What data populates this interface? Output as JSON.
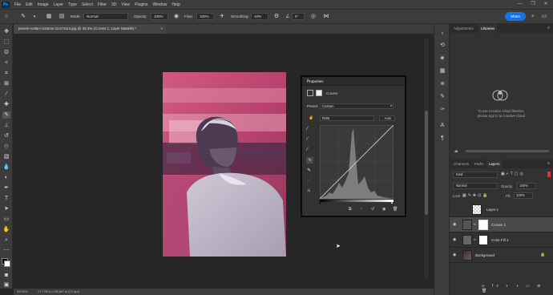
{
  "menubar": {
    "logo": "Ps",
    "items": [
      "File",
      "Edit",
      "Image",
      "Layer",
      "Type",
      "Select",
      "Filter",
      "3D",
      "View",
      "Plugins",
      "Window",
      "Help"
    ],
    "window_controls": [
      "—",
      "❐",
      "✕"
    ]
  },
  "options": {
    "mode_label": "Mode:",
    "mode_value": "Normal",
    "opacity_label": "Opacity:",
    "opacity_value": "100%",
    "flow_label": "Flow:",
    "flow_value": "100%",
    "smoothing_label": "Smoothing:",
    "smoothing_value": "10%",
    "angle_value": "0°",
    "share_label": "Share"
  },
  "document": {
    "tab_title": "pexels-ruslan-rozanov-11474114.jpg @ 33.3% (Curves 1, Layer Mask/8) *"
  },
  "status": {
    "zoom": "33.33%",
    "doc_size": "17.778 in x 26.667 in (72 ppi)"
  },
  "properties": {
    "title": "Properties",
    "layer_type": "Curves",
    "preset_label": "Preset:",
    "preset_value": "Custom",
    "channel_value": "RGB",
    "auto_label": "Auto"
  },
  "libraries": {
    "tabs": [
      "Adjustments",
      "Libraries"
    ],
    "message_line1": "To use Creative Cloud libraries,",
    "message_line2": "please sign in to Creative Cloud"
  },
  "layers_panel": {
    "tabs": [
      "Channels",
      "Paths",
      "Layers"
    ],
    "filter_value": "Kind",
    "blend_value": "Normal",
    "opacity_label": "Opacity:",
    "opacity_value": "100%",
    "lock_label": "Lock:",
    "fill_label": "Fill:",
    "fill_value": "100%",
    "layers": [
      {
        "name": "Layer 1"
      },
      {
        "name": "Curves 1"
      },
      {
        "name": "Color Fill 1"
      },
      {
        "name": "Background"
      }
    ]
  },
  "colors": {
    "accent": "#1473e6",
    "photo_pink": "#c4406b",
    "photo_shadow": "#3a2436"
  }
}
